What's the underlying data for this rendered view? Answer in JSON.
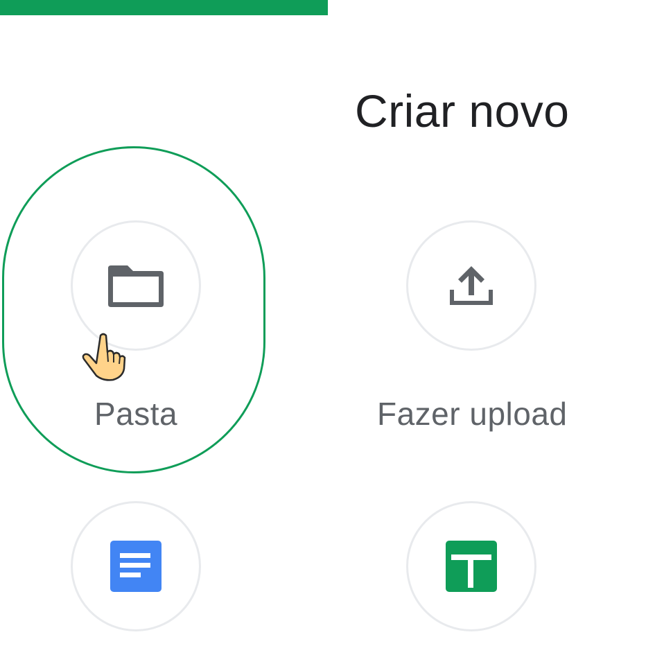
{
  "title": "Criar novo",
  "items": [
    {
      "label": "Pasta",
      "icon": "folder-icon"
    },
    {
      "label": "Fazer upload",
      "icon": "upload-icon"
    },
    {
      "label": "",
      "icon": "google-docs-icon"
    },
    {
      "label": "",
      "icon": "google-sheets-icon"
    }
  ],
  "colors": {
    "accent_green": "#0f9d58",
    "icon_gray": "#5f6368",
    "docs_blue": "#4285f4",
    "sheets_green": "#0f9d58",
    "circle_border": "#e8eaed"
  },
  "highlighted_item": "Pasta",
  "cursor": "pointing-hand-cursor-icon"
}
